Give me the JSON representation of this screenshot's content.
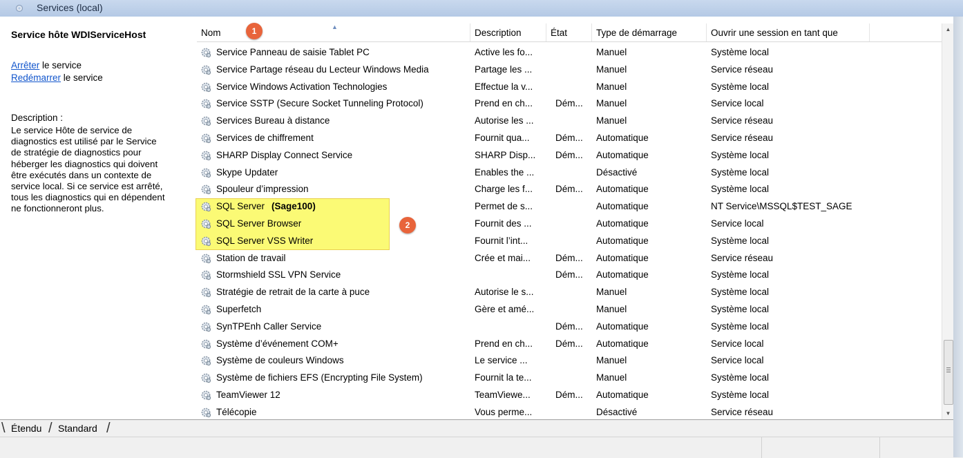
{
  "window": {
    "title": "Services (local)"
  },
  "left_pane": {
    "service_name": "Service hôte WDIServiceHost",
    "stop_link": "Arrêter",
    "stop_suffix": " le service",
    "restart_link": "Redémarrer",
    "restart_suffix": " le service",
    "description_label": "Description :",
    "description_lines": [
      "Le service Hôte de service de",
      "diagnostics est utilisé par le Service",
      "de stratégie de diagnostics pour",
      "héberger les diagnostics qui doivent",
      "être exécutés dans un contexte de",
      "service local. Si ce service est arrêté,",
      "tous les diagnostics qui en dépendent",
      "ne fonctionneront plus."
    ]
  },
  "table": {
    "columns": {
      "name": "Nom",
      "description": "Description",
      "state": "État",
      "startup": "Type de démarrage",
      "logon": "Ouvrir une session en tant que"
    },
    "rows": [
      {
        "name": "Service Panneau de saisie Tablet PC",
        "extra": "",
        "desc": "Active les fo...",
        "state": "",
        "startup": "Manuel",
        "logon": "Système local"
      },
      {
        "name": "Service Partage réseau du Lecteur Windows Media",
        "extra": "",
        "desc": "Partage les ...",
        "state": "",
        "startup": "Manuel",
        "logon": "Service réseau"
      },
      {
        "name": "Service Windows Activation Technologies",
        "extra": "",
        "desc": "Effectue la v...",
        "state": "",
        "startup": "Manuel",
        "logon": "Système local"
      },
      {
        "name": "Service SSTP (Secure Socket Tunneling Protocol)",
        "extra": "",
        "desc": "Prend en ch...",
        "state": "Dém...",
        "startup": "Manuel",
        "logon": "Service local"
      },
      {
        "name": "Services Bureau à distance",
        "extra": "",
        "desc": "Autorise les ...",
        "state": "",
        "startup": "Manuel",
        "logon": "Service réseau"
      },
      {
        "name": "Services de chiffrement",
        "extra": "",
        "desc": "Fournit qua...",
        "state": "Dém...",
        "startup": "Automatique",
        "logon": "Service réseau"
      },
      {
        "name": "SHARP Display Connect Service",
        "extra": "",
        "desc": "SHARP Disp...",
        "state": "Dém...",
        "startup": "Automatique",
        "logon": "Système local"
      },
      {
        "name": "Skype Updater",
        "extra": "",
        "desc": "Enables the ...",
        "state": "",
        "startup": "Désactivé",
        "logon": "Système local"
      },
      {
        "name": "Spouleur d’impression",
        "extra": "",
        "desc": "Charge les f...",
        "state": "Dém...",
        "startup": "Automatique",
        "logon": "Système local"
      },
      {
        "name": "SQL Server",
        "extra": "(Sage100)",
        "desc": "Permet de s...",
        "state": "",
        "startup": "Automatique",
        "logon": "NT Service\\MSSQL$TEST_SAGE"
      },
      {
        "name": "SQL Server Browser",
        "extra": "",
        "desc": "Fournit des ...",
        "state": "",
        "startup": "Automatique",
        "logon": "Service local"
      },
      {
        "name": "SQL Server VSS Writer",
        "extra": "",
        "desc": "Fournit l’int...",
        "state": "",
        "startup": "Automatique",
        "logon": "Système local"
      },
      {
        "name": "Station de travail",
        "extra": "",
        "desc": "Crée et mai...",
        "state": "Dém...",
        "startup": "Automatique",
        "logon": "Service réseau"
      },
      {
        "name": "Stormshield SSL VPN Service",
        "extra": "",
        "desc": "",
        "state": "Dém...",
        "startup": "Automatique",
        "logon": "Système local"
      },
      {
        "name": "Stratégie de retrait de la carte à puce",
        "extra": "",
        "desc": "Autorise le s...",
        "state": "",
        "startup": "Manuel",
        "logon": "Système local"
      },
      {
        "name": "Superfetch",
        "extra": "",
        "desc": "Gère et amé...",
        "state": "",
        "startup": "Manuel",
        "logon": "Système local"
      },
      {
        "name": "SynTPEnh Caller Service",
        "extra": "",
        "desc": "",
        "state": "Dém...",
        "startup": "Automatique",
        "logon": "Système local"
      },
      {
        "name": "Système d’événement COM+",
        "extra": "",
        "desc": "Prend en ch...",
        "state": "Dém...",
        "startup": "Automatique",
        "logon": "Service local"
      },
      {
        "name": "Système de couleurs Windows",
        "extra": "",
        "desc": "Le service ...",
        "state": "",
        "startup": "Manuel",
        "logon": "Service local"
      },
      {
        "name": "Système de fichiers EFS (Encrypting File System)",
        "extra": "",
        "desc": "Fournit la te...",
        "state": "",
        "startup": "Manuel",
        "logon": "Système local"
      },
      {
        "name": "TeamViewer 12",
        "extra": "",
        "desc": "TeamViewe...",
        "state": "Dém...",
        "startup": "Automatique",
        "logon": "Système local"
      },
      {
        "name": "Télécopie",
        "extra": "",
        "desc": "Vous perme...",
        "state": "",
        "startup": "Désactivé",
        "logon": "Service réseau"
      }
    ]
  },
  "annotations": {
    "badge1": "1",
    "badge2": "2",
    "highlight_color": "#fbf94f",
    "badge_color": "#e8643b"
  },
  "tabs": {
    "extended": "Étendu",
    "standard": "Standard"
  }
}
